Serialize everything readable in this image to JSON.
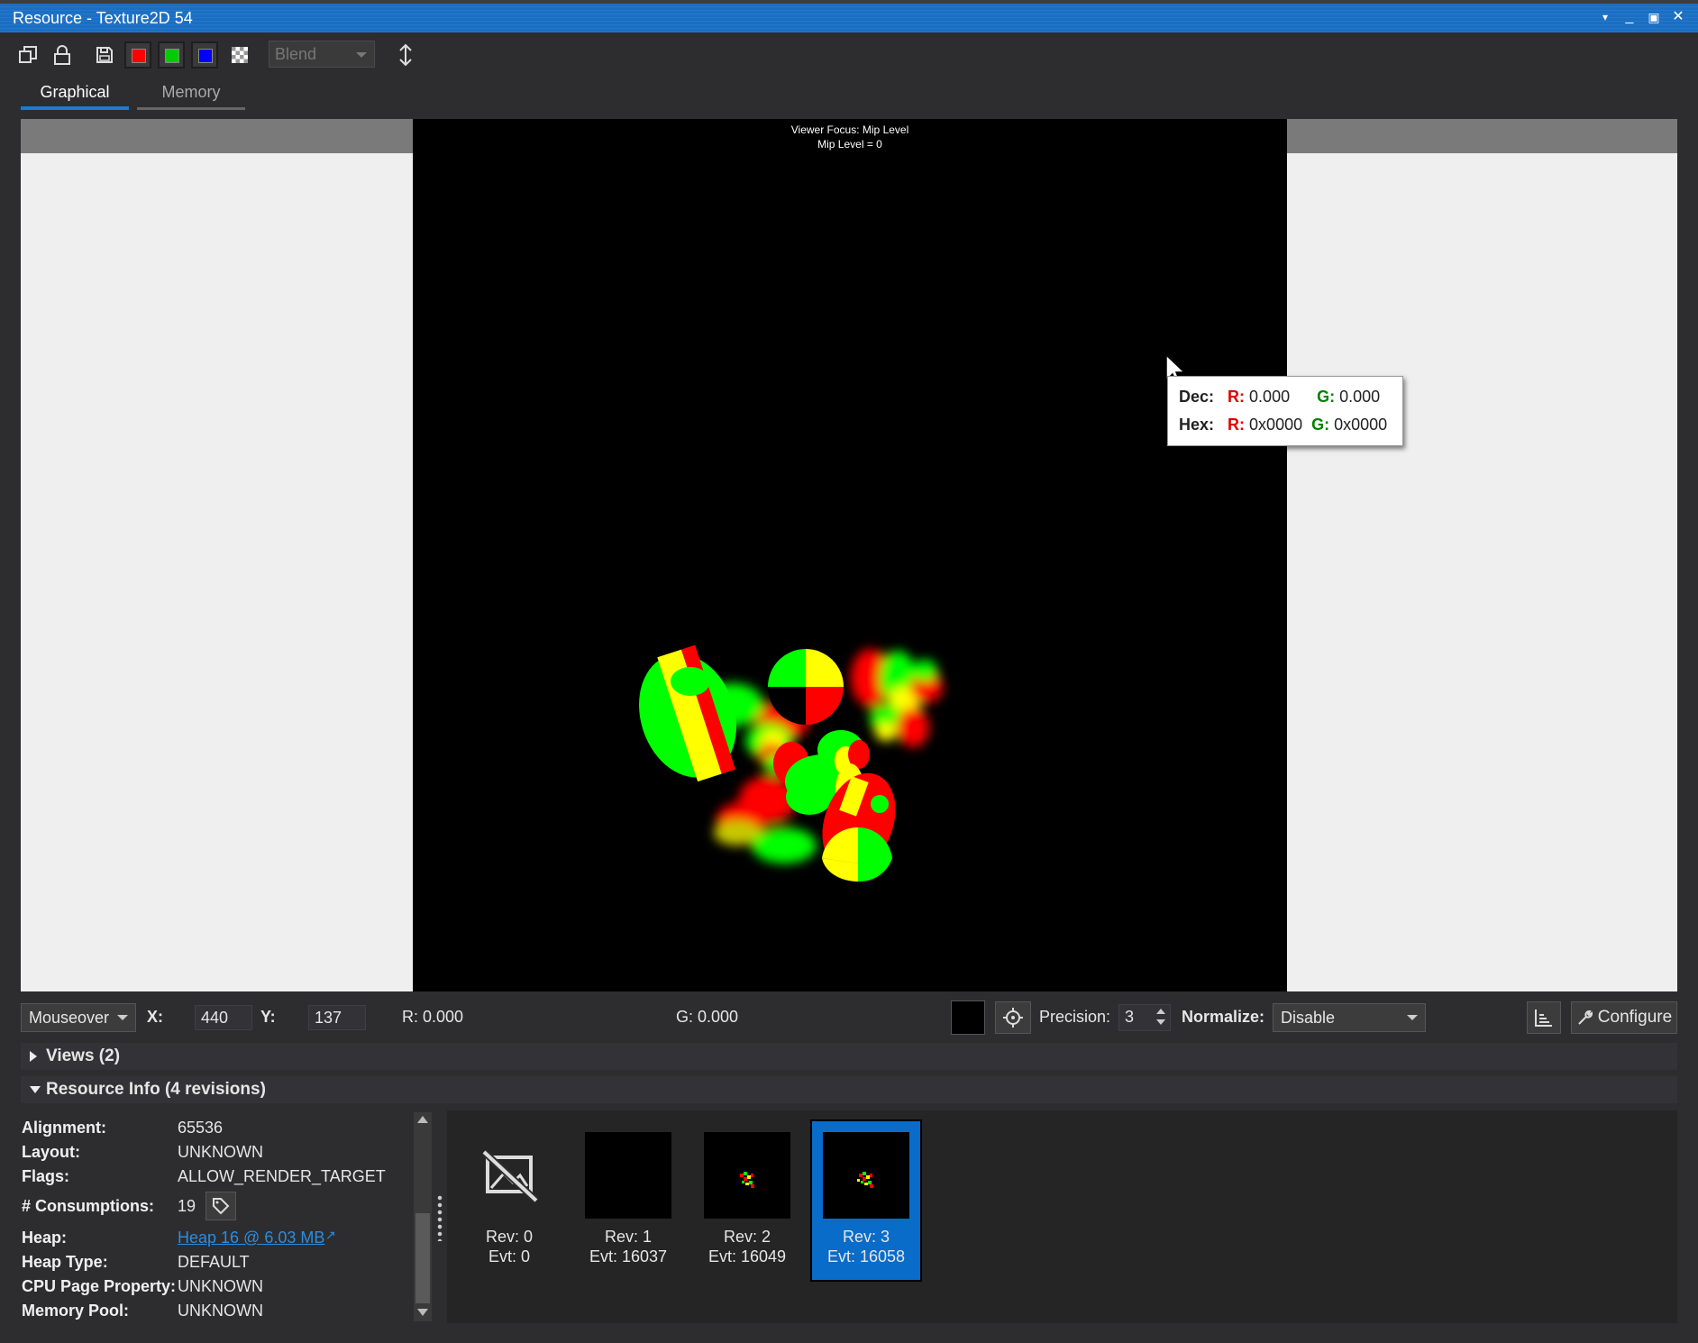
{
  "window": {
    "title": "Resource - Texture2D 54"
  },
  "toolbar": {
    "icons": [
      "copy-icon",
      "lock-icon",
      "save-icon",
      "red-channel",
      "green-channel",
      "blue-channel",
      "alpha-channel",
      "vertical-flip-icon"
    ],
    "channel_colors": {
      "red": "#ff0000",
      "green": "#00cc00",
      "blue": "#0000ff"
    },
    "blend_label": "Blend"
  },
  "tabs": [
    {
      "label": "Graphical",
      "active": true
    },
    {
      "label": "Memory",
      "active": false
    }
  ],
  "viewer": {
    "focus_line1": "Viewer Focus: Mip Level",
    "focus_line2": "Mip Level = 0"
  },
  "tooltip": {
    "dec_label": "Dec:",
    "hex_label": "Hex:",
    "r_label": "R:",
    "g_label": "G:",
    "dec_r": "0.000",
    "dec_g": "0.000",
    "hex_r": "0x0000",
    "hex_g": "0x0000"
  },
  "pixel_bar": {
    "mode": "Mouseover",
    "x_label": "X:",
    "x_value": "440",
    "y_label": "Y:",
    "y_value": "137",
    "r_text": "R: 0.000",
    "g_text": "G: 0.000",
    "precision_label": "Precision:",
    "precision_value": "3",
    "normalize_label": "Normalize:",
    "normalize_value": "Disable",
    "configure_label": "Configure"
  },
  "sections": {
    "views": "Views (2)",
    "resource_info": "Resource Info (4 revisions)"
  },
  "properties": [
    {
      "label": "Alignment:",
      "value": "65536"
    },
    {
      "label": "Layout:",
      "value": "UNKNOWN"
    },
    {
      "label": "Flags:",
      "value": "ALLOW_RENDER_TARGET"
    },
    {
      "label": "# Consumptions:",
      "value": "19"
    },
    {
      "label": "Heap:",
      "value": "Heap 16 @ 6.03 MB"
    },
    {
      "label": "Heap Type:",
      "value": "DEFAULT"
    },
    {
      "label": "CPU Page Property:",
      "value": "UNKNOWN"
    },
    {
      "label": "Memory Pool:",
      "value": "UNKNOWN"
    }
  ],
  "revisions": [
    {
      "rev": "Rev: 0",
      "evt": "Evt: 0",
      "selected": false
    },
    {
      "rev": "Rev: 1",
      "evt": "Evt: 16037",
      "selected": false
    },
    {
      "rev": "Rev: 2",
      "evt": "Evt: 16049",
      "selected": false
    },
    {
      "rev": "Rev: 3",
      "evt": "Evt: 16058",
      "selected": true
    }
  ]
}
